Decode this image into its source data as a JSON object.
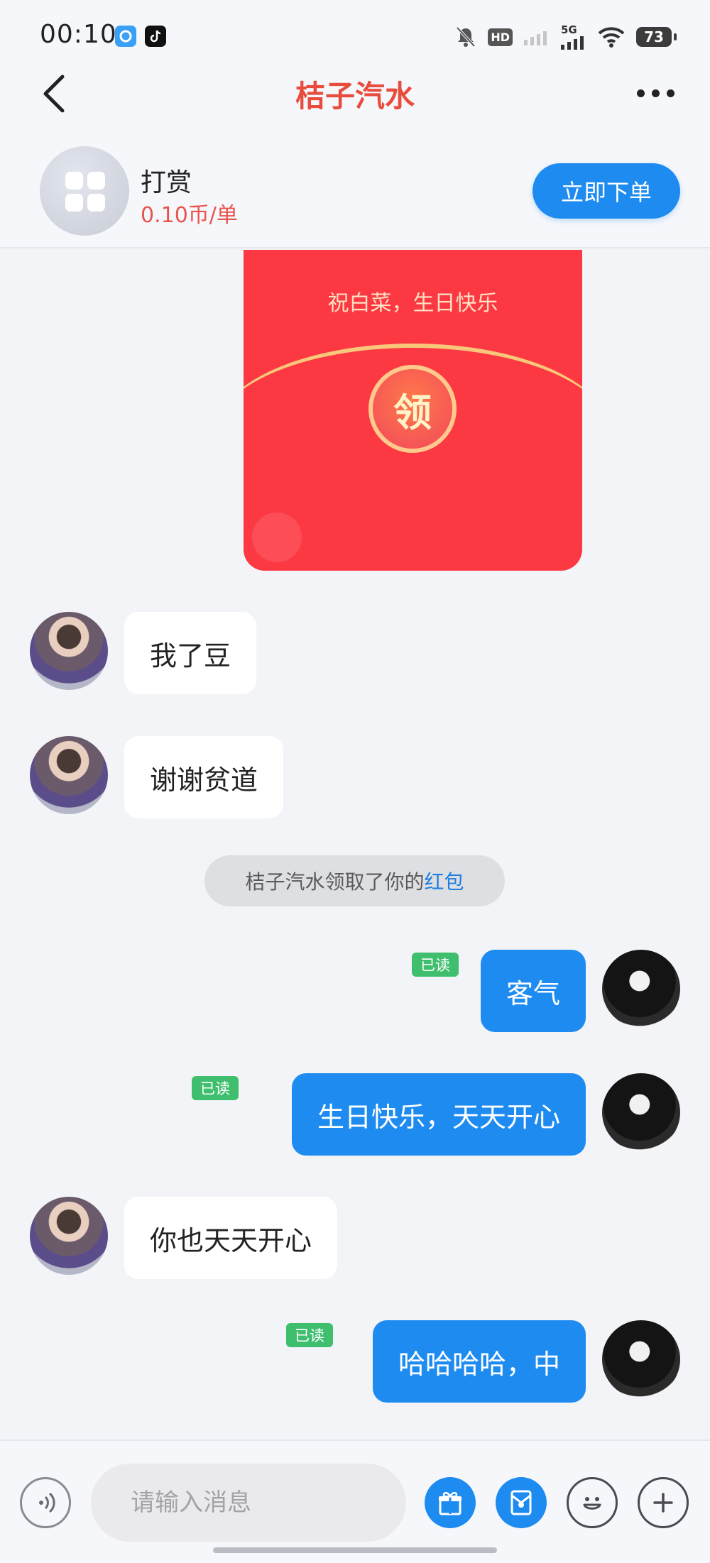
{
  "status_bar": {
    "time": "00:10",
    "network": "5G",
    "hd_badge": "HD",
    "battery": "73"
  },
  "header": {
    "title": "桔子汽水"
  },
  "service": {
    "title": "打赏",
    "price": "0.10币/单",
    "order_button": "立即下单"
  },
  "red_packet": {
    "greeting": "祝白菜，生日快乐",
    "claim_label": "领"
  },
  "messages": [
    {
      "side": "in",
      "text": "我了豆"
    },
    {
      "side": "in",
      "text": "谢谢贫道"
    },
    {
      "side": "out",
      "text": "客气",
      "read": "已读"
    },
    {
      "side": "out",
      "text": "生日快乐，天天开心",
      "read": "已读"
    },
    {
      "side": "in",
      "text": "你也天天开心"
    },
    {
      "side": "out",
      "text": "哈哈哈哈，中",
      "read": "已读"
    }
  ],
  "system_note": {
    "text": "桔子汽水领取了你的",
    "link": "红包"
  },
  "input": {
    "placeholder": "请输入消息"
  },
  "colors": {
    "accent_blue": "#1e8bf0",
    "title_red": "#e84c3d",
    "packet_red": "#fc3843",
    "read_green": "#3fbf6e"
  }
}
